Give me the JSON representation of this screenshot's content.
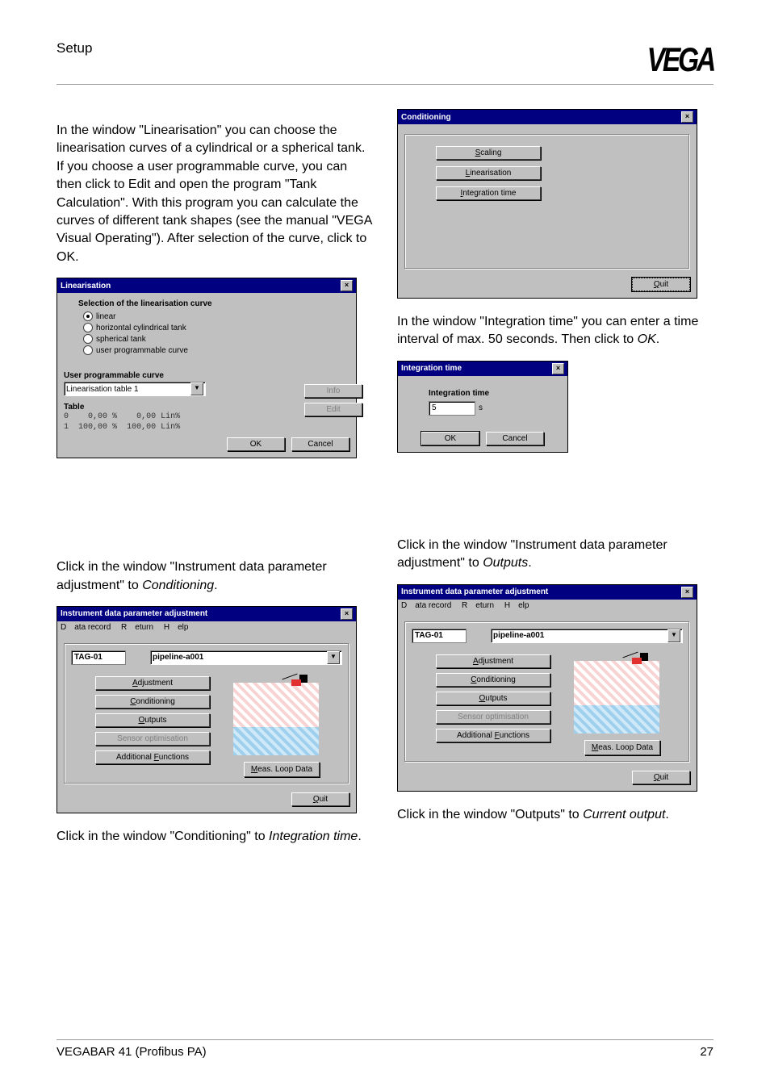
{
  "header": {
    "title": "Setup",
    "logo": "VEGA"
  },
  "text": {
    "p1": "In the window \"Linearisation\" you can choose the linearisation curves of a cylindrical or a spherical tank. If you choose a user programmable curve, you can then click to Edit and open the program \"Tank Calculation\". With this program you can calculate the curves of different tank shapes (see the manual \"VEGA Visual Operating\"). After selection of the curve, click to OK.",
    "p2a": "Click in the window \"Instrument data parameter adjustment\" to ",
    "p2b_ital": "Conditioning",
    "p2c": ".",
    "p3a": "Click in the window \"Conditioning\" to ",
    "p3b_ital": "Integration time",
    "p3c": ".",
    "p4a": "In the window \"Integration time\" you can enter a time interval of max. 50 seconds. Then click to ",
    "p4b_ital": "OK",
    "p4c": ".",
    "p5a": "Click in the window \"Instrument data parameter adjustment\" to ",
    "p5b_ital": "Outputs",
    "p5c": ".",
    "p6a": "Click in the window \"Outputs\" to ",
    "p6b_ital": "Current output",
    "p6c": "."
  },
  "lin": {
    "title": "Linearisation",
    "groupTitle": "Selection of the linearisation curve",
    "options": [
      "linear",
      "horizontal cylindrical tank",
      "spherical tank",
      "user programmable curve"
    ],
    "selectedIndex": 0,
    "userLabel": "User programmable curve",
    "dropdownVal": "Linearisation table 1",
    "tableLabel": "Table",
    "tableRows": [
      {
        "i": "0",
        "pct": "0,00 %",
        "val": "0,00 Lin%"
      },
      {
        "i": "1",
        "pct": "100,00 %",
        "val": "100,00 Lin%"
      }
    ],
    "info": "Info",
    "edit": "Edit",
    "ok": "OK",
    "cancel": "Cancel"
  },
  "cond": {
    "title": "Conditioning",
    "btns": [
      "Scaling",
      "Linearisation",
      "Integration time"
    ],
    "quit": "Quit"
  },
  "integ": {
    "title": "Integration time",
    "label": "Integration time",
    "value": "5",
    "unit": "s",
    "ok": "OK",
    "cancel": "Cancel"
  },
  "inparam": {
    "title": "Instrument data parameter adjustment",
    "menu": {
      "data": "Data record",
      "ret": "Return",
      "help": "Help"
    },
    "tagLabel": "TAG-01",
    "tagValue": "pipeline-a001",
    "btns": [
      "Adjustment",
      "Conditioning",
      "Outputs",
      "Sensor optimisation",
      "Additional Functions"
    ],
    "disabledIndex": 3,
    "measLoop": "Meas. Loop Data",
    "quit": "Quit"
  },
  "footer": {
    "left": "VEGABAR 41 (Profibus PA)",
    "right": "27"
  }
}
